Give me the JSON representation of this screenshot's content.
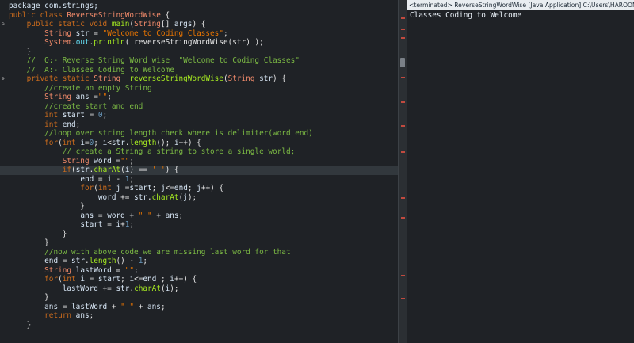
{
  "editor": {
    "current_line": 18,
    "lines": [
      [
        [
          "id",
          "package com.strings;"
        ]
      ],
      [
        [
          "kw",
          "public class "
        ],
        [
          "type",
          "ReverseStringWordWise"
        ],
        [
          "pn",
          " {"
        ]
      ],
      [
        [
          "pn",
          "    "
        ],
        [
          "kw",
          "public static void "
        ],
        [
          "meth",
          "main"
        ],
        [
          "pn",
          "("
        ],
        [
          "type",
          "String"
        ],
        [
          "pn",
          "[] "
        ],
        [
          "id",
          "args"
        ],
        [
          "pn",
          ") {"
        ]
      ],
      [
        [
          "pn",
          "        "
        ],
        [
          "type",
          "String "
        ],
        [
          "id",
          "str"
        ],
        [
          "pn",
          " = "
        ],
        [
          "str",
          "\"Welcome to Coding Classes\""
        ],
        [
          "pn",
          ";"
        ]
      ],
      [
        [
          "pn",
          "        "
        ],
        [
          "type",
          "System"
        ],
        [
          "pn",
          "."
        ],
        [
          "fld",
          "out"
        ],
        [
          "pn",
          "."
        ],
        [
          "meth",
          "println"
        ],
        [
          "pn",
          "( reverseStringWordWise(str) );"
        ]
      ],
      [
        [
          "pn",
          "    }"
        ]
      ],
      [
        [
          "pn",
          "    "
        ],
        [
          "cmt",
          "//  Q:- Reverse String Word wise  \"Welcome to Coding Classes\""
        ]
      ],
      [
        [
          "pn",
          "    "
        ],
        [
          "cmt",
          "//  A:- Classes Coding to Welcome"
        ]
      ],
      [
        [
          "pn",
          "    "
        ],
        [
          "kw",
          "private static "
        ],
        [
          "type",
          "String  "
        ],
        [
          "meth",
          "reverseStringWordWise"
        ],
        [
          "pn",
          "("
        ],
        [
          "type",
          "String "
        ],
        [
          "id",
          "str"
        ],
        [
          "pn",
          ") {"
        ]
      ],
      [
        [
          "pn",
          "        "
        ],
        [
          "cmt",
          "//create an empty String"
        ]
      ],
      [
        [
          "pn",
          "        "
        ],
        [
          "type",
          "String "
        ],
        [
          "id",
          "ans"
        ],
        [
          "pn",
          " ="
        ],
        [
          "str",
          "\"\""
        ],
        [
          "pn",
          ";"
        ]
      ],
      [
        [
          "pn",
          "        "
        ],
        [
          "cmt",
          "//create start and end"
        ]
      ],
      [
        [
          "pn",
          "        "
        ],
        [
          "kw",
          "int "
        ],
        [
          "id",
          "start"
        ],
        [
          "pn",
          " = "
        ],
        [
          "num",
          "0"
        ],
        [
          "pn",
          ";"
        ]
      ],
      [
        [
          "pn",
          "        "
        ],
        [
          "kw",
          "int "
        ],
        [
          "id",
          "end"
        ],
        [
          "pn",
          ";"
        ]
      ],
      [
        [
          "pn",
          "        "
        ],
        [
          "cmt",
          "//loop over string length check where is delimiter(word end)"
        ]
      ],
      [
        [
          "pn",
          "        "
        ],
        [
          "kw",
          "for"
        ],
        [
          "pn",
          "("
        ],
        [
          "kw",
          "int "
        ],
        [
          "id",
          "i"
        ],
        [
          "pn",
          "="
        ],
        [
          "num",
          "0"
        ],
        [
          "pn",
          "; "
        ],
        [
          "id",
          "i"
        ],
        [
          "pn",
          "<"
        ],
        [
          "id",
          "str"
        ],
        [
          "pn",
          "."
        ],
        [
          "meth",
          "length"
        ],
        [
          "pn",
          "(); "
        ],
        [
          "id",
          "i"
        ],
        [
          "pn",
          "++) {"
        ]
      ],
      [
        [
          "pn",
          "            "
        ],
        [
          "cmt",
          "// create a String a string to store a single world;"
        ]
      ],
      [
        [
          "pn",
          "            "
        ],
        [
          "type",
          "String "
        ],
        [
          "id",
          "word"
        ],
        [
          "pn",
          " ="
        ],
        [
          "str",
          "\"\""
        ],
        [
          "pn",
          ";"
        ]
      ],
      [
        [
          "pn",
          "            "
        ],
        [
          "kw",
          "if"
        ],
        [
          "pn",
          "("
        ],
        [
          "id",
          "str"
        ],
        [
          "pn",
          "."
        ],
        [
          "meth",
          "charAt"
        ],
        [
          "pn",
          "("
        ],
        [
          "id",
          "i"
        ],
        [
          "pn",
          ") == "
        ],
        [
          "str",
          "' '"
        ],
        [
          "pn",
          ") {"
        ]
      ],
      [
        [
          "pn",
          "                "
        ],
        [
          "id",
          "end"
        ],
        [
          "pn",
          " = "
        ],
        [
          "id",
          "i"
        ],
        [
          "pn",
          " - "
        ],
        [
          "num",
          "1"
        ],
        [
          "pn",
          ";"
        ]
      ],
      [
        [
          "pn",
          "                "
        ],
        [
          "kw",
          "for"
        ],
        [
          "pn",
          "("
        ],
        [
          "kw",
          "int "
        ],
        [
          "id",
          "j"
        ],
        [
          "pn",
          " ="
        ],
        [
          "id",
          "start"
        ],
        [
          "pn",
          "; "
        ],
        [
          "id",
          "j"
        ],
        [
          "pn",
          "<="
        ],
        [
          "id",
          "end"
        ],
        [
          "pn",
          "; "
        ],
        [
          "id",
          "j"
        ],
        [
          "pn",
          "++) {"
        ]
      ],
      [
        [
          "pn",
          "                    "
        ],
        [
          "id",
          "word"
        ],
        [
          "pn",
          " += "
        ],
        [
          "id",
          "str"
        ],
        [
          "pn",
          "."
        ],
        [
          "meth",
          "charAt"
        ],
        [
          "pn",
          "("
        ],
        [
          "id",
          "j"
        ],
        [
          "pn",
          ");"
        ]
      ],
      [
        [
          "pn",
          "                }"
        ]
      ],
      [
        [
          "pn",
          "                "
        ],
        [
          "id",
          "ans"
        ],
        [
          "pn",
          " = "
        ],
        [
          "id",
          "word"
        ],
        [
          "pn",
          " + "
        ],
        [
          "str",
          "\" \""
        ],
        [
          "pn",
          " + "
        ],
        [
          "id",
          "ans"
        ],
        [
          "pn",
          ";"
        ]
      ],
      [
        [
          "pn",
          "                "
        ],
        [
          "id",
          "start"
        ],
        [
          "pn",
          " = "
        ],
        [
          "id",
          "i"
        ],
        [
          "pn",
          "+"
        ],
        [
          "num",
          "1"
        ],
        [
          "pn",
          ";"
        ]
      ],
      [
        [
          "pn",
          "            }"
        ]
      ],
      [
        [
          "pn",
          "        }"
        ]
      ],
      [
        [
          "pn",
          "        "
        ],
        [
          "cmt",
          "//now with above code we are missing last word for that"
        ]
      ],
      [
        [
          "pn",
          "        "
        ],
        [
          "id",
          "end"
        ],
        [
          "pn",
          " = "
        ],
        [
          "id",
          "str"
        ],
        [
          "pn",
          "."
        ],
        [
          "meth",
          "length"
        ],
        [
          "pn",
          "() - "
        ],
        [
          "num",
          "1"
        ],
        [
          "pn",
          ";"
        ]
      ],
      [
        [
          "pn",
          "        "
        ],
        [
          "type",
          "String "
        ],
        [
          "id",
          "lastWord"
        ],
        [
          "pn",
          " = "
        ],
        [
          "str",
          "\"\""
        ],
        [
          "pn",
          ";"
        ]
      ],
      [
        [
          "pn",
          "        "
        ],
        [
          "kw",
          "for"
        ],
        [
          "pn",
          "("
        ],
        [
          "kw",
          "int "
        ],
        [
          "id",
          "i"
        ],
        [
          "pn",
          " = "
        ],
        [
          "id",
          "start"
        ],
        [
          "pn",
          "; "
        ],
        [
          "id",
          "i"
        ],
        [
          "pn",
          "<="
        ],
        [
          "id",
          "end"
        ],
        [
          "pn",
          " ; "
        ],
        [
          "id",
          "i"
        ],
        [
          "pn",
          "++) {"
        ]
      ],
      [
        [
          "pn",
          "            "
        ],
        [
          "id",
          "lastWord"
        ],
        [
          "pn",
          " += "
        ],
        [
          "id",
          "str"
        ],
        [
          "pn",
          "."
        ],
        [
          "meth",
          "charAt"
        ],
        [
          "pn",
          "("
        ],
        [
          "id",
          "i"
        ],
        [
          "pn",
          ");"
        ]
      ],
      [
        [
          "pn",
          "        }"
        ]
      ],
      [
        [
          "pn",
          "        "
        ],
        [
          "id",
          "ans"
        ],
        [
          "pn",
          " = "
        ],
        [
          "id",
          "lastWord"
        ],
        [
          "pn",
          " + "
        ],
        [
          "str",
          "\" \""
        ],
        [
          "pn",
          " + "
        ],
        [
          "id",
          "ans"
        ],
        [
          "pn",
          ";"
        ]
      ],
      [
        [
          "pn",
          "        "
        ],
        [
          "kw",
          "return "
        ],
        [
          "id",
          "ans"
        ],
        [
          "pn",
          ";"
        ]
      ],
      [
        [
          "pn",
          "    }"
        ]
      ]
    ]
  },
  "console": {
    "header": "<terminated> ReverseStringWordWise [Java Application] C:\\Users\\HAROON KHANDAY\\",
    "output": "Classes Coding to Welcome"
  },
  "colors": {
    "background": "#1f2226",
    "keyword": "#cc6c1d",
    "string": "#ec7600",
    "comment": "#7cba44",
    "method": "#a7ec21",
    "identifier": "#d9e8f7"
  }
}
